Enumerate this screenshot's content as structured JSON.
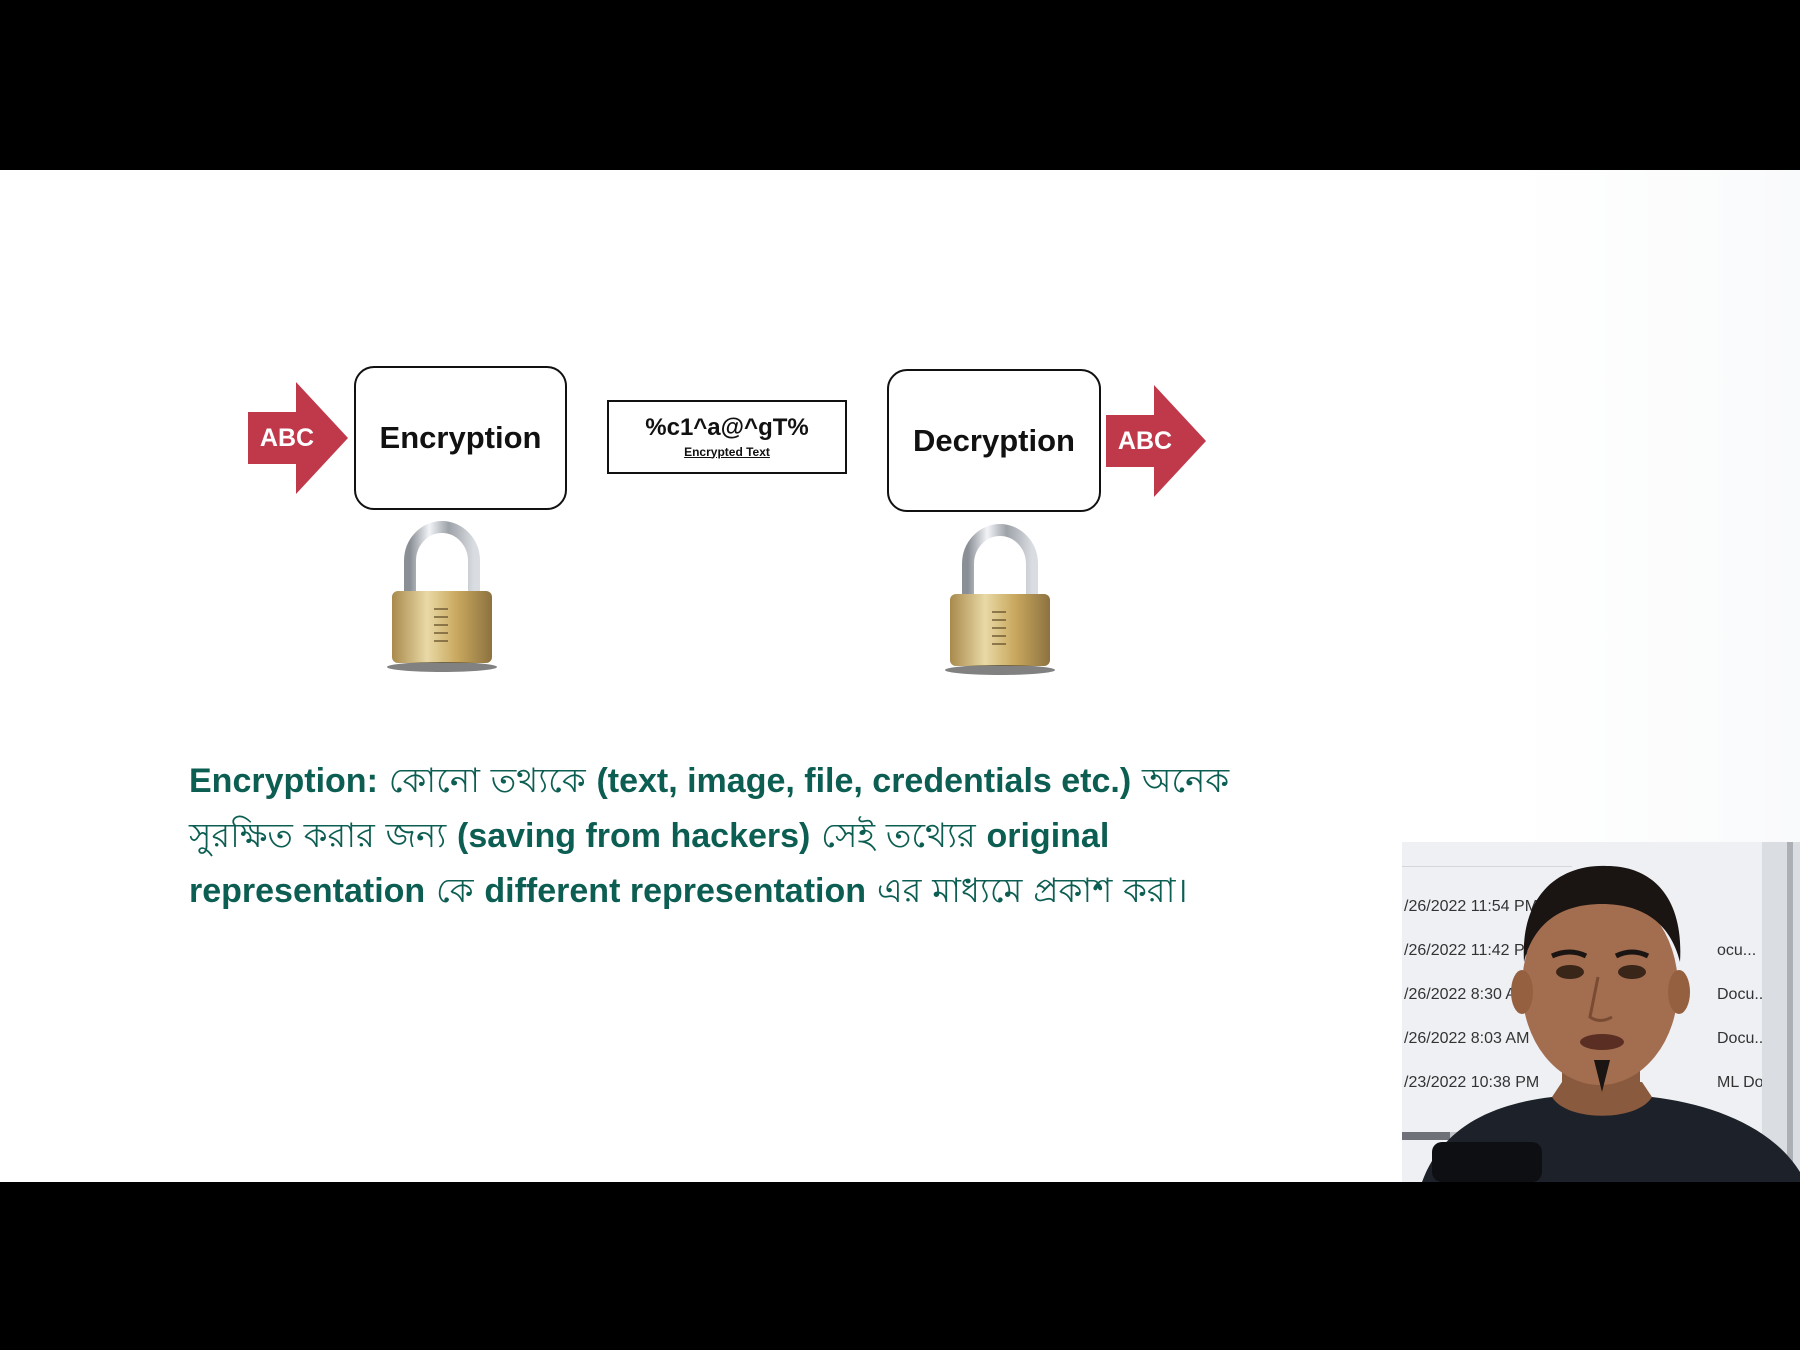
{
  "diagram": {
    "input_label": "ABC",
    "output_label": "ABC",
    "encrypt_label": "Encryption",
    "decrypt_label": "Decryption",
    "cipher_text": "%c1^a@^gT%",
    "cipher_caption": "Encrypted Text"
  },
  "definition": {
    "term": "Encryption:",
    "part1": " কোনো তথ্যকে ",
    "part2": "(text, image, file, credentials etc.)",
    "part3": " অনেক সুরক্ষিত করার জন্য ",
    "part4": "(saving from hackers)",
    "part5": " সেই তথ্যের ",
    "part6": "original representation",
    "part7": " কে ",
    "part8": "different representation",
    "part9": " এর মাধ্যমে প্রকাশ করা।"
  },
  "webcam": {
    "file_rows": [
      {
        "date": "/26/2022 11:54 PM",
        "type": ""
      },
      {
        "date": "/26/2022 11:42 PM",
        "type": "ocu..."
      },
      {
        "date": "/26/2022 8:30 AM",
        "type": "Docu..."
      },
      {
        "date": "/26/2022 8:03 AM",
        "type": "Docu..."
      },
      {
        "date": "/23/2022 10:38 PM",
        "type": "ML Docu..."
      }
    ]
  },
  "colors": {
    "arrow_red": "#c0394b",
    "definition_green": "#0d5e52",
    "lock_gold": "#c9a85e"
  }
}
